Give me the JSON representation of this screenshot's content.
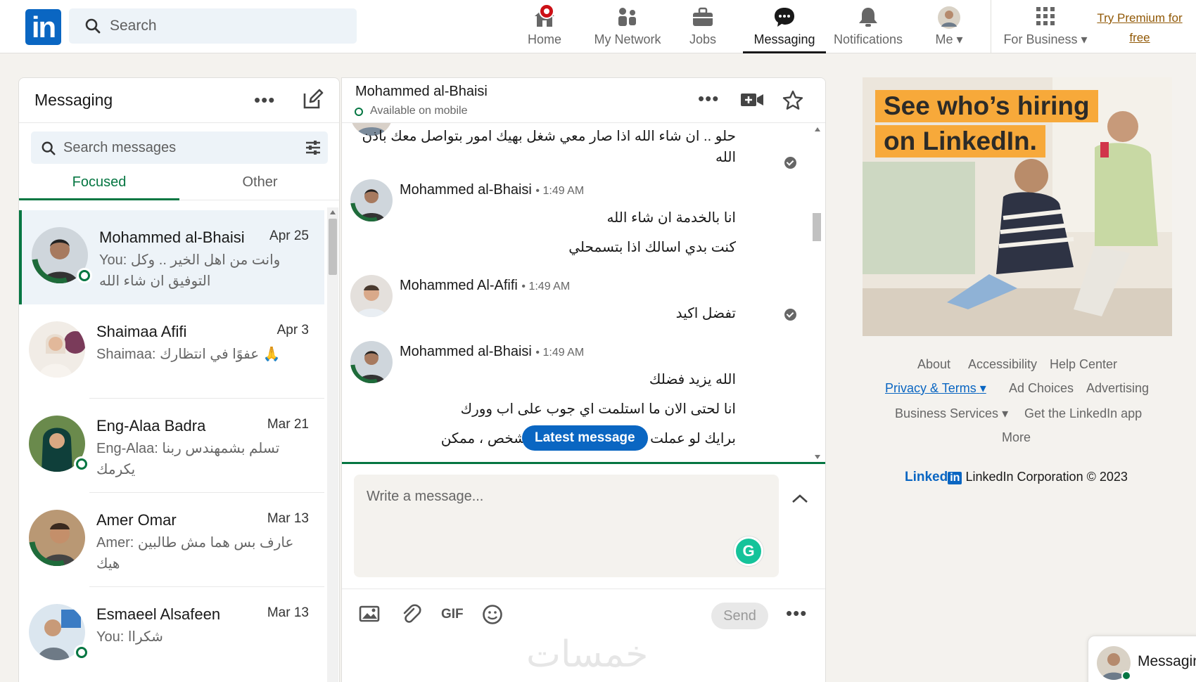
{
  "nav": {
    "search_placeholder": "Search",
    "home": "Home",
    "network": "My Network",
    "jobs": "Jobs",
    "messaging": "Messaging",
    "notifications": "Notifications",
    "me": "Me",
    "business": "For Business",
    "premium_line1": "Try Premium for",
    "premium_line2": "free"
  },
  "list": {
    "title": "Messaging",
    "search_placeholder": "Search messages",
    "tab_focused": "Focused",
    "tab_other": "Other",
    "conversations": [
      {
        "name": "Mohammed al-Bhaisi",
        "date": "Apr 25",
        "snippet": "You: وانت من اهل الخير .. وكل التوفيق ان شاء الله"
      },
      {
        "name": "Shaimaa Afifi",
        "date": "Apr 3",
        "snippet": "Shaimaa: عفوًا في انتظارك 🙏"
      },
      {
        "name": "Eng-Alaa Badra",
        "date": "Mar 21",
        "snippet": "Eng-Alaa: تسلم بشمهندس ربنا يكرمك"
      },
      {
        "name": "Amer Omar",
        "date": "Mar 13",
        "snippet": "Amer: عارف بس هما مش طالبين هيك"
      },
      {
        "name": "Esmaeel Alsafeen",
        "date": "Mar 13",
        "snippet": "You: شكراا"
      }
    ]
  },
  "thread": {
    "name": "Mohammed al-Bhaisi",
    "status": "Available on mobile",
    "messages": [
      {
        "text": "حلو .. ان شاء الله اذا صار معي شغل بهيك امور بتواصل معك باذن الله"
      },
      {
        "sender": "Mohammed al-Bhaisi",
        "time": "• 1:49 AM",
        "lines": [
          "انا بالخدمة ان شاء الله",
          "كنت بدي اسالك اذا بتسمحلي"
        ]
      },
      {
        "sender": "Mohammed Al-Afifi",
        "time": "• 1:49 AM",
        "lines": [
          "تفضل اكيد"
        ]
      },
      {
        "sender": "Mohammed al-Bhaisi",
        "time": "• 1:49 AM",
        "lines": [
          "الله يزيد فضلك",
          "انا لحتى الان ما استلمت اي جوب على اب وورك",
          "برايك لو عملت جوب عن طريقي مع شخص ، ممكن"
        ]
      }
    ],
    "latest_button": "Latest message",
    "composer_placeholder": "Write a message...",
    "gif_label": "GIF",
    "send_label": "Send",
    "watermark": "خمسات"
  },
  "ad": {
    "line1": "See who’s hiring",
    "line2": "on LinkedIn."
  },
  "footer": {
    "about": "About",
    "accessibility": "Accessibility",
    "help": "Help Center",
    "privacy": "Privacy & Terms",
    "adchoices": "Ad Choices",
    "advertising": "Advertising",
    "business_services": "Business Services",
    "get_app": "Get the LinkedIn app",
    "more": "More",
    "corp_brand": "Linked",
    "corp_brand_box": "in",
    "corp_text": "LinkedIn Corporation © 2023"
  },
  "mini_messaging": {
    "label": "Messaging"
  },
  "colors": {
    "brand": "#0a66c2",
    "green": "#057642",
    "premium": "#915907",
    "badge": "#cc1016"
  }
}
